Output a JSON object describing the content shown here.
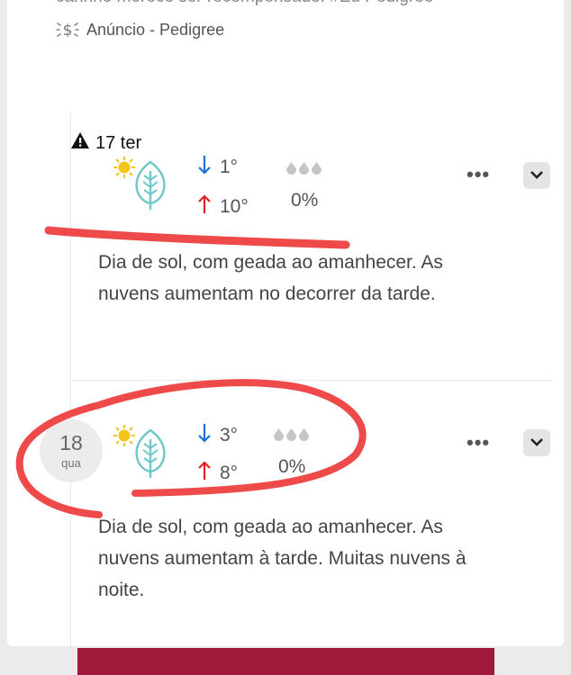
{
  "ad": {
    "partial_text": "carinho merece ser recompensado. #Eu Pedigree",
    "label": "Anúncio - Pedigree",
    "icon": "sponsored-dollar-icon"
  },
  "days": [
    {
      "date_label": "17 ter",
      "warning_icon": "warning-triangle-icon",
      "condition_icon": "sun-icon",
      "secondary_icon": "leaf-icon",
      "min_temp": "1°",
      "max_temp": "10°",
      "precip": "0%",
      "description": "Dia de sol, com geada ao amanhecer. As nuvens aumentam no decorrer da tarde."
    },
    {
      "date_num": "18",
      "weekday": "qua",
      "condition_icon": "sun-icon",
      "secondary_icon": "leaf-icon",
      "min_temp": "3°",
      "max_temp": "8°",
      "precip": "0%",
      "description": "Dia de sol, com geada ao amanhecer. As nuvens aumentam à tarde. Muitas nuvens à noite."
    }
  ],
  "colors": {
    "min_arrow": "#1a73d9",
    "max_arrow": "#e0241f",
    "leaf": "#6fc7c7",
    "sun": "#f5c518",
    "annotation": "#ef4a4a",
    "bottom_block": "#a0183a"
  }
}
